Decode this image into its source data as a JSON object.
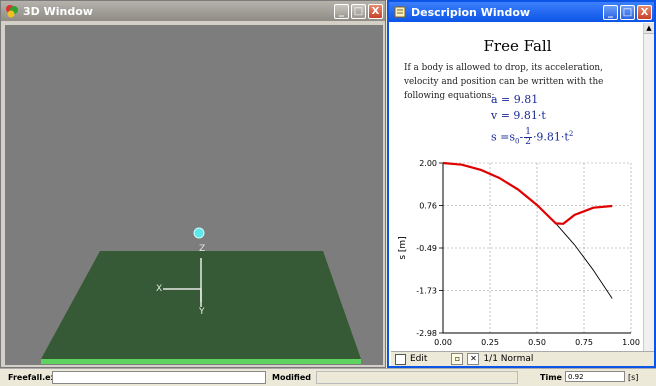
{
  "window_3d": {
    "title": "3D Window",
    "buttons": {
      "minimize": "_",
      "maximize": "□",
      "close": "X"
    },
    "axes": {
      "z": "Z",
      "x": "X",
      "y": "Y"
    },
    "colors": {
      "background": "#7d7d7d",
      "floor": "#355a35",
      "floor_edge": "#5fd35f",
      "ball": "#5fe8ea"
    }
  },
  "desc_window": {
    "title": "Descripion Window",
    "buttons": {
      "minimize": "_",
      "maximize": "□",
      "close": "X"
    },
    "heading": "Free Fall",
    "paragraph": "If a body is allowed to drop, its acceleration, velocity and position  can be written with the following equations:",
    "eq_a": "a = 9.81",
    "eq_v": "v  = 9.81·t",
    "eq_s_prefix": "s =s",
    "eq_s_sub": "0",
    "eq_s_mid": "-",
    "eq_s_num": "1",
    "eq_s_den": "2",
    "eq_s_tail": "·9.81·t",
    "eq_s_sup": "2",
    "footer": {
      "edit": "Edit",
      "page": "1/1 Normal"
    }
  },
  "chart_data": {
    "type": "line",
    "ylabel": "s [m]",
    "xlabel": "",
    "xlim": [
      0.0,
      1.0
    ],
    "ylim": [
      -2.98,
      2.0
    ],
    "x_ticks": [
      "0.00",
      "0.25",
      "0.50",
      "0.75",
      "1.00"
    ],
    "y_ticks": [
      "2.00",
      "0.76",
      "-0.49",
      "-1.73",
      "-2.98"
    ],
    "grid": true,
    "series": [
      {
        "color": "#000000",
        "x": [
          0.0,
          0.1,
          0.2,
          0.3,
          0.4,
          0.5,
          0.6,
          0.7,
          0.8,
          0.9
        ],
        "values": [
          2.0,
          1.95,
          1.8,
          1.56,
          1.22,
          0.77,
          0.23,
          -0.4,
          -1.14,
          -1.97
        ]
      },
      {
        "color": "#e00000",
        "x": [
          0.0,
          0.1,
          0.2,
          0.3,
          0.4,
          0.5,
          0.6,
          0.64,
          0.7,
          0.8,
          0.9
        ],
        "values": [
          2.0,
          1.95,
          1.8,
          1.56,
          1.22,
          0.77,
          0.23,
          0.22,
          0.48,
          0.69,
          0.74
        ]
      }
    ]
  },
  "status_bar": {
    "file": "Freefall.ex",
    "modified": "Modified",
    "time_label": "Time",
    "time_value": "0.92",
    "time_unit": "[s]"
  }
}
